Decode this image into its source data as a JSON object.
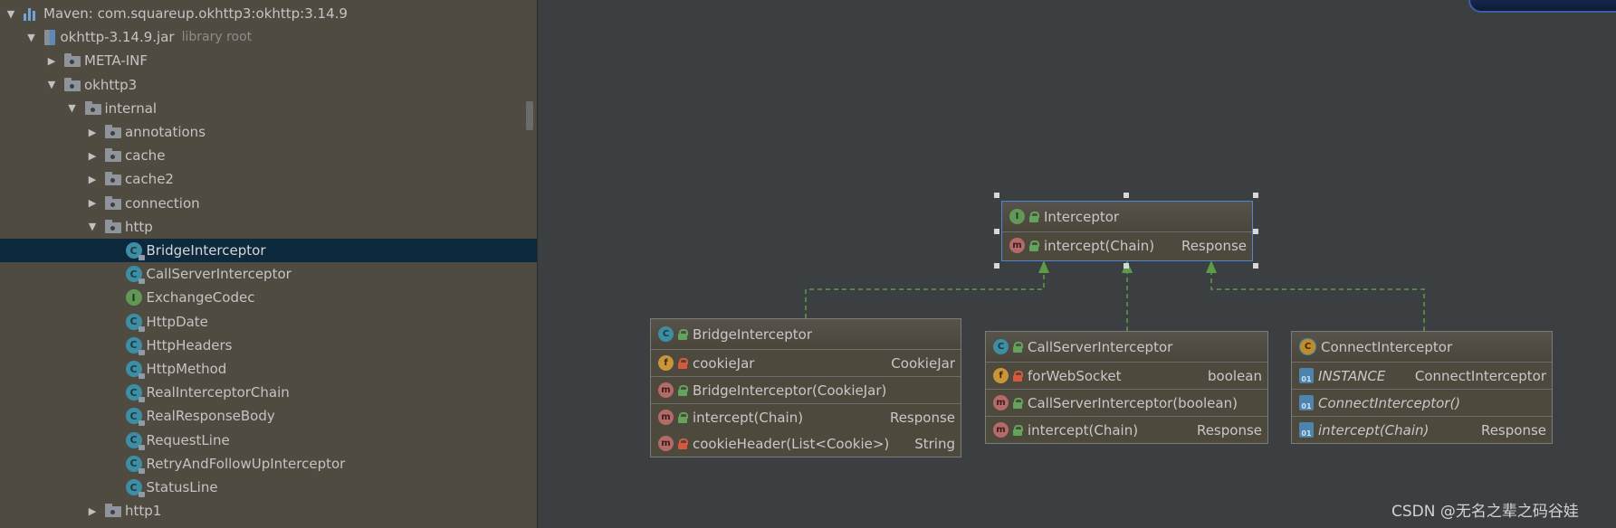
{
  "tree": {
    "rows": [
      {
        "label": "Maven: com.squareup.okhttp3:okhttp:3.14.9",
        "sub": "",
        "icon": "maven-library-icon",
        "arrow": "open",
        "indent": 0
      },
      {
        "label": "okhttp-3.14.9.jar",
        "sub": "library root",
        "icon": "jar-icon",
        "arrow": "open",
        "indent": 1
      },
      {
        "label": "META-INF",
        "sub": "",
        "icon": "package-icon",
        "arrow": "closed",
        "indent": 2
      },
      {
        "label": "okhttp3",
        "sub": "",
        "icon": "package-icon",
        "arrow": "open",
        "indent": 2
      },
      {
        "label": "internal",
        "sub": "",
        "icon": "package-icon",
        "arrow": "open",
        "indent": 3
      },
      {
        "label": "annotations",
        "sub": "",
        "icon": "package-icon",
        "arrow": "closed",
        "indent": 4
      },
      {
        "label": "cache",
        "sub": "",
        "icon": "package-icon",
        "arrow": "closed",
        "indent": 4
      },
      {
        "label": "cache2",
        "sub": "",
        "icon": "package-icon",
        "arrow": "closed",
        "indent": 4
      },
      {
        "label": "connection",
        "sub": "",
        "icon": "package-icon",
        "arrow": "closed",
        "indent": 4
      },
      {
        "label": "http",
        "sub": "",
        "icon": "package-icon",
        "arrow": "open",
        "indent": 4
      },
      {
        "label": "BridgeInterceptor",
        "sub": "",
        "icon": "class-icon",
        "arrow": "none",
        "indent": 5,
        "selected": true
      },
      {
        "label": "CallServerInterceptor",
        "sub": "",
        "icon": "class-icon",
        "arrow": "none",
        "indent": 5
      },
      {
        "label": "ExchangeCodec",
        "sub": "",
        "icon": "interface-icon",
        "arrow": "none",
        "indent": 5
      },
      {
        "label": "HttpDate",
        "sub": "",
        "icon": "class-icon",
        "arrow": "none",
        "indent": 5
      },
      {
        "label": "HttpHeaders",
        "sub": "",
        "icon": "class-icon",
        "arrow": "none",
        "indent": 5
      },
      {
        "label": "HttpMethod",
        "sub": "",
        "icon": "class-icon",
        "arrow": "none",
        "indent": 5
      },
      {
        "label": "RealInterceptorChain",
        "sub": "",
        "icon": "class-icon",
        "arrow": "none",
        "indent": 5
      },
      {
        "label": "RealResponseBody",
        "sub": "",
        "icon": "class-icon",
        "arrow": "none",
        "indent": 5
      },
      {
        "label": "RequestLine",
        "sub": "",
        "icon": "class-icon",
        "arrow": "none",
        "indent": 5
      },
      {
        "label": "RetryAndFollowUpInterceptor",
        "sub": "",
        "icon": "class-icon",
        "arrow": "none",
        "indent": 5
      },
      {
        "label": "StatusLine",
        "sub": "",
        "icon": "class-icon",
        "arrow": "none",
        "indent": 5
      },
      {
        "label": "http1",
        "sub": "",
        "icon": "package-icon",
        "arrow": "closed",
        "indent": 4
      }
    ]
  },
  "diagram": {
    "interceptor": {
      "name": "Interceptor",
      "kind": "I",
      "methods": [
        {
          "name": "intercept(Chain)",
          "type": "Response",
          "kind": "m"
        }
      ]
    },
    "bridge": {
      "name": "BridgeInterceptor",
      "kind": "C",
      "fields": [
        {
          "name": "cookieJar",
          "type": "CookieJar",
          "kind": "f"
        }
      ],
      "constructors": [
        {
          "name": "BridgeInterceptor(CookieJar)",
          "type": "",
          "kind": "m"
        }
      ],
      "methods": [
        {
          "name": "intercept(Chain)",
          "type": "Response",
          "kind": "m"
        },
        {
          "name": "cookieHeader(List<Cookie>)",
          "type": "String",
          "kind": "m"
        }
      ]
    },
    "callserver": {
      "name": "CallServerInterceptor",
      "kind": "C",
      "fields": [
        {
          "name": "forWebSocket",
          "type": "boolean",
          "kind": "f"
        }
      ],
      "constructors": [
        {
          "name": "CallServerInterceptor(boolean)",
          "type": "",
          "kind": "m"
        }
      ],
      "methods": [
        {
          "name": "intercept(Chain)",
          "type": "Response",
          "kind": "m"
        }
      ]
    },
    "connect": {
      "name": "ConnectInterceptor",
      "kind": "C",
      "fields": [
        {
          "name": "INSTANCE",
          "type": "ConnectInterceptor",
          "kind": "st"
        }
      ],
      "constructors": [
        {
          "name": "ConnectInterceptor()",
          "type": "",
          "kind": "st"
        }
      ],
      "methods": [
        {
          "name": "intercept(Chain)",
          "type": "Response",
          "kind": "st"
        }
      ]
    },
    "badges": {
      "I": "I",
      "C": "C",
      "m": "m",
      "f": "f",
      "st": "01"
    }
  },
  "watermark": "CSDN @无名之辈之码谷娃",
  "colors": {
    "tree_bg": "#4f4b41",
    "selected_row": "#0d293e",
    "editor_bg": "#3c3f41",
    "uml_box": "#4d4a3d",
    "arrow_green": "#5c9b48",
    "selection_border": "#4f87d6"
  }
}
